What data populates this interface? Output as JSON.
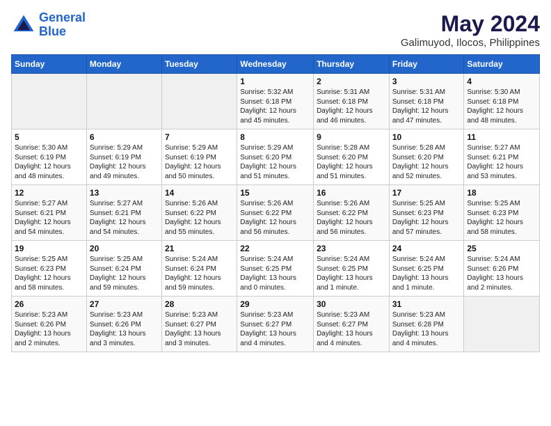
{
  "header": {
    "logo_line1": "General",
    "logo_line2": "Blue",
    "month_year": "May 2024",
    "location": "Galimuyod, Ilocos, Philippines"
  },
  "weekdays": [
    "Sunday",
    "Monday",
    "Tuesday",
    "Wednesday",
    "Thursday",
    "Friday",
    "Saturday"
  ],
  "weeks": [
    [
      {
        "day": "",
        "info": ""
      },
      {
        "day": "",
        "info": ""
      },
      {
        "day": "",
        "info": ""
      },
      {
        "day": "1",
        "info": "Sunrise: 5:32 AM\nSunset: 6:18 PM\nDaylight: 12 hours\nand 45 minutes."
      },
      {
        "day": "2",
        "info": "Sunrise: 5:31 AM\nSunset: 6:18 PM\nDaylight: 12 hours\nand 46 minutes."
      },
      {
        "day": "3",
        "info": "Sunrise: 5:31 AM\nSunset: 6:18 PM\nDaylight: 12 hours\nand 47 minutes."
      },
      {
        "day": "4",
        "info": "Sunrise: 5:30 AM\nSunset: 6:18 PM\nDaylight: 12 hours\nand 48 minutes."
      }
    ],
    [
      {
        "day": "5",
        "info": "Sunrise: 5:30 AM\nSunset: 6:19 PM\nDaylight: 12 hours\nand 48 minutes."
      },
      {
        "day": "6",
        "info": "Sunrise: 5:29 AM\nSunset: 6:19 PM\nDaylight: 12 hours\nand 49 minutes."
      },
      {
        "day": "7",
        "info": "Sunrise: 5:29 AM\nSunset: 6:19 PM\nDaylight: 12 hours\nand 50 minutes."
      },
      {
        "day": "8",
        "info": "Sunrise: 5:29 AM\nSunset: 6:20 PM\nDaylight: 12 hours\nand 51 minutes."
      },
      {
        "day": "9",
        "info": "Sunrise: 5:28 AM\nSunset: 6:20 PM\nDaylight: 12 hours\nand 51 minutes."
      },
      {
        "day": "10",
        "info": "Sunrise: 5:28 AM\nSunset: 6:20 PM\nDaylight: 12 hours\nand 52 minutes."
      },
      {
        "day": "11",
        "info": "Sunrise: 5:27 AM\nSunset: 6:21 PM\nDaylight: 12 hours\nand 53 minutes."
      }
    ],
    [
      {
        "day": "12",
        "info": "Sunrise: 5:27 AM\nSunset: 6:21 PM\nDaylight: 12 hours\nand 54 minutes."
      },
      {
        "day": "13",
        "info": "Sunrise: 5:27 AM\nSunset: 6:21 PM\nDaylight: 12 hours\nand 54 minutes."
      },
      {
        "day": "14",
        "info": "Sunrise: 5:26 AM\nSunset: 6:22 PM\nDaylight: 12 hours\nand 55 minutes."
      },
      {
        "day": "15",
        "info": "Sunrise: 5:26 AM\nSunset: 6:22 PM\nDaylight: 12 hours\nand 56 minutes."
      },
      {
        "day": "16",
        "info": "Sunrise: 5:26 AM\nSunset: 6:22 PM\nDaylight: 12 hours\nand 56 minutes."
      },
      {
        "day": "17",
        "info": "Sunrise: 5:25 AM\nSunset: 6:23 PM\nDaylight: 12 hours\nand 57 minutes."
      },
      {
        "day": "18",
        "info": "Sunrise: 5:25 AM\nSunset: 6:23 PM\nDaylight: 12 hours\nand 58 minutes."
      }
    ],
    [
      {
        "day": "19",
        "info": "Sunrise: 5:25 AM\nSunset: 6:23 PM\nDaylight: 12 hours\nand 58 minutes."
      },
      {
        "day": "20",
        "info": "Sunrise: 5:25 AM\nSunset: 6:24 PM\nDaylight: 12 hours\nand 59 minutes."
      },
      {
        "day": "21",
        "info": "Sunrise: 5:24 AM\nSunset: 6:24 PM\nDaylight: 12 hours\nand 59 minutes."
      },
      {
        "day": "22",
        "info": "Sunrise: 5:24 AM\nSunset: 6:25 PM\nDaylight: 13 hours\nand 0 minutes."
      },
      {
        "day": "23",
        "info": "Sunrise: 5:24 AM\nSunset: 6:25 PM\nDaylight: 13 hours\nand 1 minute."
      },
      {
        "day": "24",
        "info": "Sunrise: 5:24 AM\nSunset: 6:25 PM\nDaylight: 13 hours\nand 1 minute."
      },
      {
        "day": "25",
        "info": "Sunrise: 5:24 AM\nSunset: 6:26 PM\nDaylight: 13 hours\nand 2 minutes."
      }
    ],
    [
      {
        "day": "26",
        "info": "Sunrise: 5:23 AM\nSunset: 6:26 PM\nDaylight: 13 hours\nand 2 minutes."
      },
      {
        "day": "27",
        "info": "Sunrise: 5:23 AM\nSunset: 6:26 PM\nDaylight: 13 hours\nand 3 minutes."
      },
      {
        "day": "28",
        "info": "Sunrise: 5:23 AM\nSunset: 6:27 PM\nDaylight: 13 hours\nand 3 minutes."
      },
      {
        "day": "29",
        "info": "Sunrise: 5:23 AM\nSunset: 6:27 PM\nDaylight: 13 hours\nand 4 minutes."
      },
      {
        "day": "30",
        "info": "Sunrise: 5:23 AM\nSunset: 6:27 PM\nDaylight: 13 hours\nand 4 minutes."
      },
      {
        "day": "31",
        "info": "Sunrise: 5:23 AM\nSunset: 6:28 PM\nDaylight: 13 hours\nand 4 minutes."
      },
      {
        "day": "",
        "info": ""
      }
    ]
  ]
}
